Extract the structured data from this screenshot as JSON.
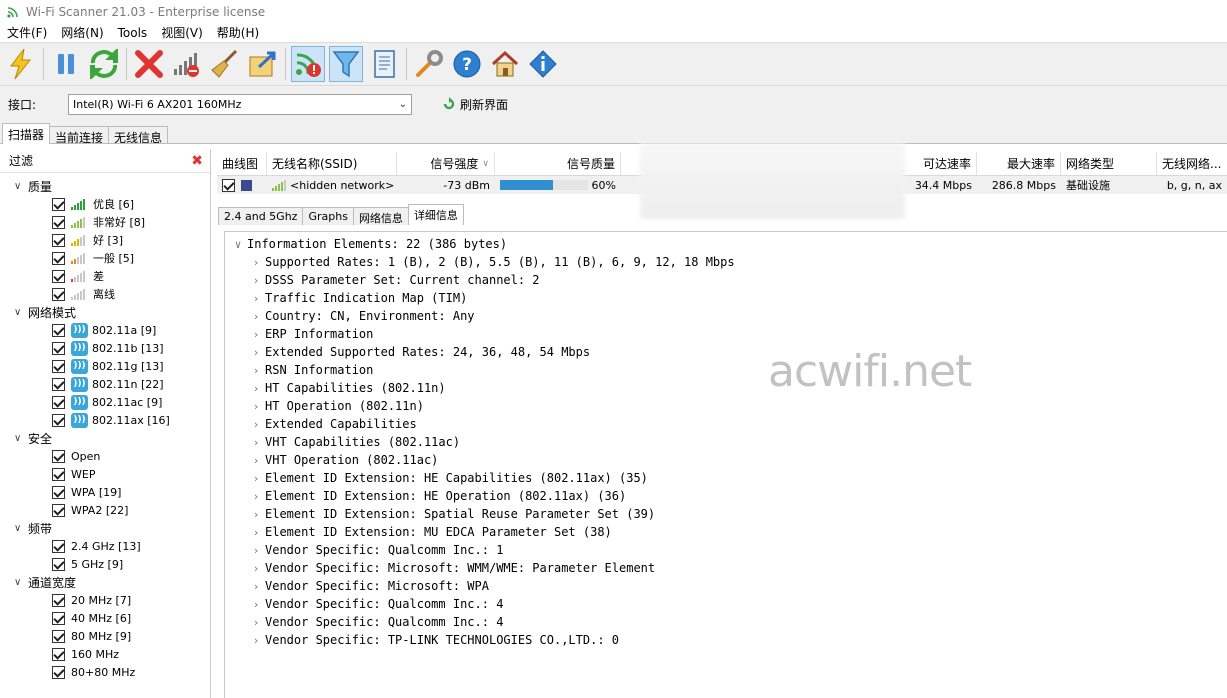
{
  "window": {
    "title": "Wi-Fi Scanner 21.03 - Enterprise license"
  },
  "menu": [
    "文件(F)",
    "网络(N)",
    "Tools",
    "视图(V)",
    "帮助(H)"
  ],
  "interface": {
    "label": "接口:",
    "selected": "Intel(R) Wi-Fi 6 AX201 160MHz",
    "refresh_label": "刷新界面"
  },
  "top_tabs": [
    "扫描器",
    "当前连接",
    "无线信息"
  ],
  "filter": {
    "title": "过滤",
    "groups": [
      {
        "name": "质量",
        "items": [
          "优良 [6]",
          "非常好 [8]",
          "好 [3]",
          "一般 [5]",
          "差",
          "离线"
        ]
      },
      {
        "name": "网络模式",
        "items": [
          "802.11a [9]",
          "802.11b [13]",
          "802.11g [13]",
          "802.11n [22]",
          "802.11ac [9]",
          "802.11ax [16]"
        ]
      },
      {
        "name": "安全",
        "items": [
          "Open",
          "WEP",
          "WPA [19]",
          "WPA2 [22]"
        ]
      },
      {
        "name": "频带",
        "items": [
          "2.4 GHz [13]",
          "5 GHz [9]"
        ]
      },
      {
        "name": "通道宽度",
        "items": [
          "20 MHz [7]",
          "40 MHz [6]",
          "80 MHz [9]",
          "160 MHz",
          "80+80 MHz"
        ]
      }
    ]
  },
  "grid": {
    "columns": [
      "曲线图",
      "无线名称(SSID)",
      "信号强度",
      "信号质量",
      "可达速率",
      "最大速率",
      "网络类型",
      "无线网络..."
    ],
    "rows": [
      {
        "ssid": "<hidden network>",
        "signal": "-73 dBm",
        "quality": 60,
        "quality_text": "60%",
        "rate": "34.4 Mbps",
        "max_rate": "286.8 Mbps",
        "net_type": "基础设施",
        "modes": "b, g, n, ax",
        "color": "#3b4a8c"
      }
    ]
  },
  "detail_tabs": [
    "2.4 and 5Ghz",
    "Graphs",
    "网络信息",
    "详细信息"
  ],
  "detail": {
    "root": "Information Elements: 22 (386 bytes)",
    "items": [
      "Supported Rates: 1 (B), 2 (B), 5.5 (B), 11 (B), 6, 9, 12, 18 Mbps",
      "DSSS Parameter Set: Current channel: 2",
      "Traffic Indication Map (TIM)",
      "Country: CN, Environment: Any",
      "ERP Information",
      "Extended Supported Rates: 24, 36, 48, 54 Mbps",
      "RSN Information",
      "HT Capabilities (802.11n)",
      "HT Operation (802.11n)",
      "Extended Capabilities",
      "VHT Capabilities (802.11ac)",
      "VHT Operation (802.11ac)",
      "Element ID Extension: HE Capabilities (802.11ax) (35)",
      "Element ID Extension: HE Operation (802.11ax) (36)",
      "Element ID Extension: Spatial Reuse Parameter Set (39)",
      "Element ID Extension: MU EDCA Parameter Set (38)",
      "Vendor Specific: Qualcomm Inc.: 1",
      "Vendor Specific: Microsoft: WMM/WME: Parameter Element",
      "Vendor Specific: Microsoft: WPA",
      "Vendor Specific: Qualcomm Inc.: 4",
      "Vendor Specific: Qualcomm Inc.: 4",
      "Vendor Specific: TP-LINK TECHNOLOGIES CO.,LTD.: 0"
    ]
  },
  "watermark": "acwifi.net",
  "colors": {
    "accent": "#2f8fd1",
    "close_red": "#e0342f"
  }
}
